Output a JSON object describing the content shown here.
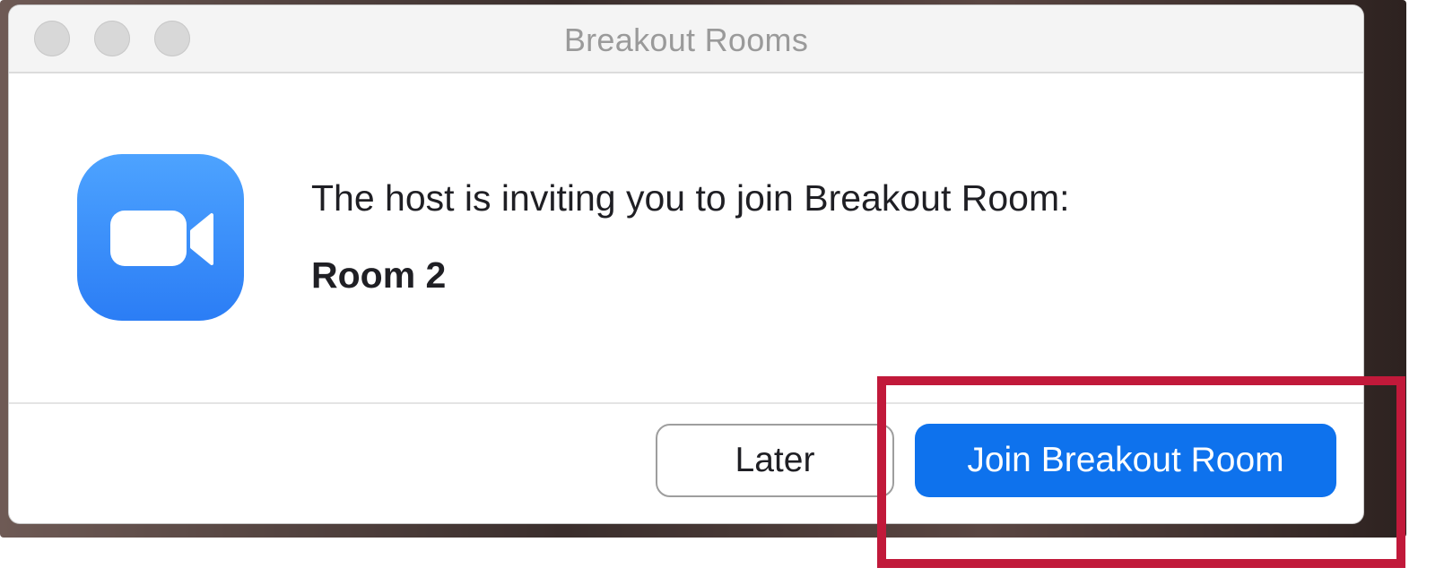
{
  "window": {
    "title": "Breakout Rooms"
  },
  "dialog": {
    "message": "The host is inviting you to join Breakout Room:",
    "room_name": "Room 2",
    "app_icon": "zoom-camera-icon"
  },
  "buttons": {
    "later_label": "Later",
    "join_label": "Join Breakout Room"
  },
  "colors": {
    "accent": "#0e72ed",
    "icon_bg": "#2d8cff",
    "highlight": "#c1193a"
  }
}
